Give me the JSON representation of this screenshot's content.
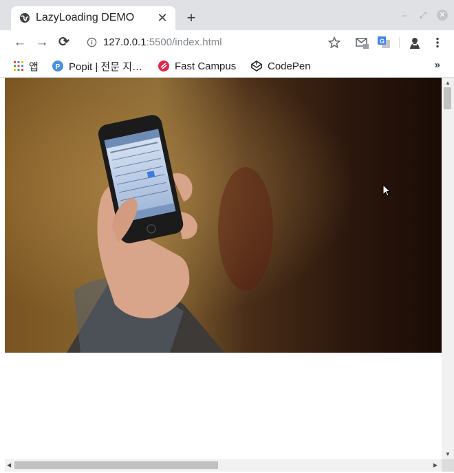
{
  "tab": {
    "title": "LazyLoading DEMO",
    "close_glyph": "✕",
    "favicon_icon": "globe-icon"
  },
  "newtab_glyph": "+",
  "window_controls": {
    "minimize": "–",
    "restore": "⤢",
    "close": "✕"
  },
  "toolbar": {
    "back_glyph": "←",
    "forward_glyph": "→",
    "reload_glyph": "⟳",
    "url_host": "127.0.0.1",
    "url_rest": ":5500/index.html",
    "icons": [
      "info-icon",
      "star-icon",
      "gmail-icon",
      "translate-icon",
      "avatar-icon",
      "menu-icon"
    ]
  },
  "bookmarks": {
    "apps_label": "앱",
    "items": [
      {
        "label": "Popit | 전문 지…"
      },
      {
        "label": "Fast Campus"
      },
      {
        "label": "CodePen"
      }
    ],
    "more_glyph": "»"
  },
  "content": {
    "hero_image": "photo of a hand holding a smartphone showing a calendar app"
  },
  "colors": {
    "tabstrip_bg": "#dfe1e5",
    "accent": "#1a73e8"
  }
}
